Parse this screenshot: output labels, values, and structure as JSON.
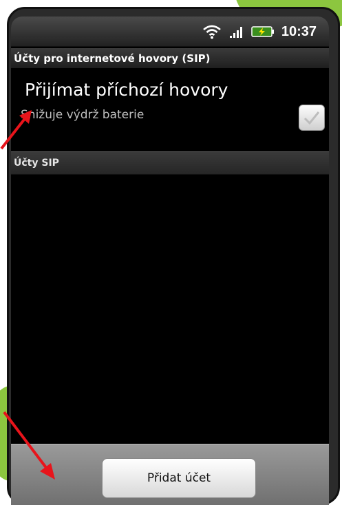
{
  "status_bar": {
    "wifi_icon": "wifi-icon",
    "signal_icon": "signal-icon",
    "battery_icon": "battery-charging-icon",
    "time": "10:37"
  },
  "titlebar": {
    "title": "Účty pro internetové hovory (SIP)"
  },
  "receive_calls": {
    "title": "Přijímat příchozí hovory",
    "summary": "Snižuje výdrž baterie",
    "checked": true
  },
  "sip_accounts": {
    "header": "Účty SIP"
  },
  "bottom": {
    "add_account_label": "Přidat účet"
  },
  "colors": {
    "accent_green": "#8cc63f",
    "annotation_red": "#e8141b"
  }
}
